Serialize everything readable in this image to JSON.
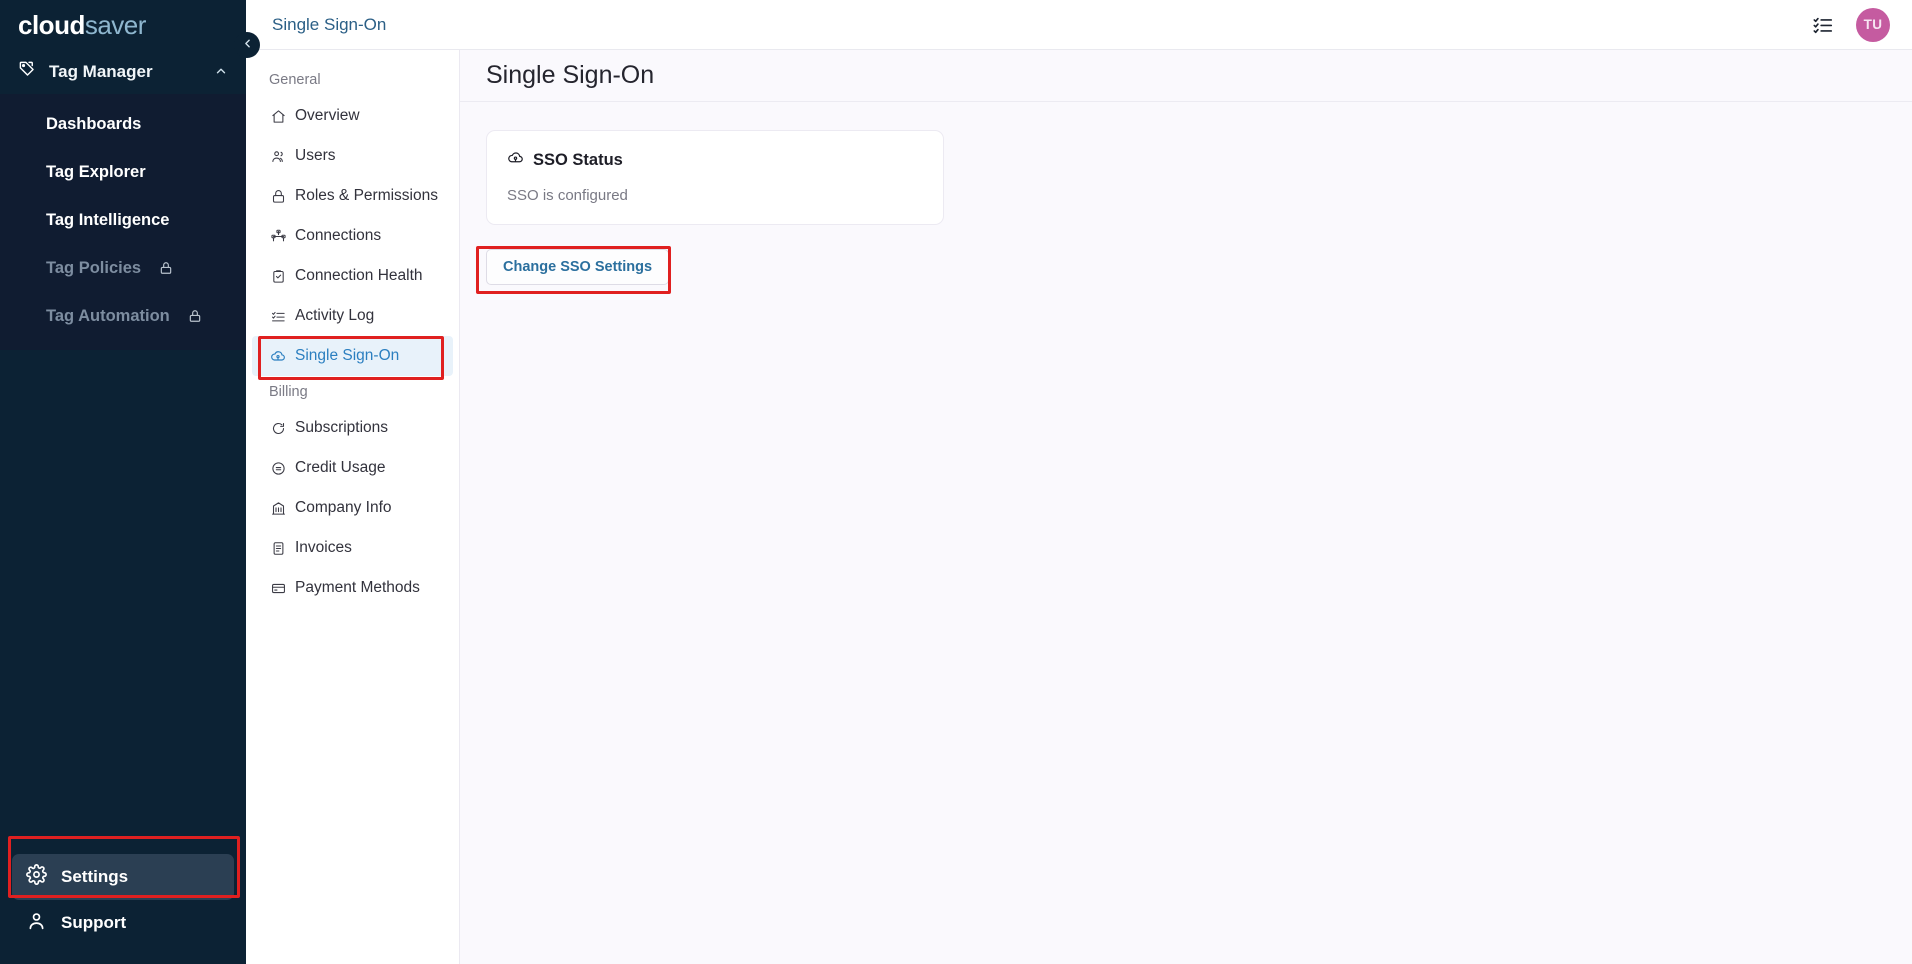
{
  "brand": {
    "part1": "cloud",
    "part2": "saver"
  },
  "sidebar": {
    "group": {
      "label": "Tag Manager",
      "icon": "tag-icon",
      "chevron": "chevron-up-icon"
    },
    "items": [
      {
        "label": "Dashboards",
        "locked": false
      },
      {
        "label": "Tag Explorer",
        "locked": false
      },
      {
        "label": "Tag Intelligence",
        "locked": false
      },
      {
        "label": "Tag Policies",
        "locked": true
      },
      {
        "label": "Tag Automation",
        "locked": true
      }
    ],
    "bottom": [
      {
        "label": "Settings",
        "icon": "gear-icon",
        "active": true
      },
      {
        "label": "Support",
        "icon": "user-support-icon",
        "active": false
      }
    ],
    "collapse_icon": "chevron-left-icon"
  },
  "topbar": {
    "title": "Single Sign-On",
    "list_icon": "checklist-icon",
    "avatar_initials": "TU"
  },
  "subnav": {
    "sections": [
      {
        "title": "General",
        "items": [
          {
            "label": "Overview",
            "icon": "home-icon",
            "active": false
          },
          {
            "label": "Users",
            "icon": "users-icon",
            "active": false
          },
          {
            "label": "Roles & Permissions",
            "icon": "lock-icon",
            "active": false
          },
          {
            "label": "Connections",
            "icon": "connections-icon",
            "active": false
          },
          {
            "label": "Connection Health",
            "icon": "clipboard-check-icon",
            "active": false
          },
          {
            "label": "Activity Log",
            "icon": "activity-list-icon",
            "active": false
          },
          {
            "label": "Single Sign-On",
            "icon": "cloud-key-icon",
            "active": true
          }
        ]
      },
      {
        "title": "Billing",
        "items": [
          {
            "label": "Subscriptions",
            "icon": "refresh-icon",
            "active": false
          },
          {
            "label": "Credit Usage",
            "icon": "coin-icon",
            "active": false
          },
          {
            "label": "Company Info",
            "icon": "building-icon",
            "active": false
          },
          {
            "label": "Invoices",
            "icon": "invoice-icon",
            "active": false
          },
          {
            "label": "Payment Methods",
            "icon": "card-icon",
            "active": false
          }
        ]
      }
    ]
  },
  "main": {
    "title": "Single Sign-On",
    "card": {
      "icon": "cloud-key-icon",
      "title": "SSO Status",
      "status_text": "SSO is configured"
    },
    "change_button": "Change SSO Settings"
  },
  "colors": {
    "sidebar_bg": "#0c2234",
    "sidebar_group_bg": "#101c31",
    "accent_blue": "#2b7fc0",
    "active_nav_bg": "#e8f2fa",
    "main_bg": "#faf9fd",
    "avatar_bg": "#c55ba0",
    "annotation_red": "#e02020"
  }
}
